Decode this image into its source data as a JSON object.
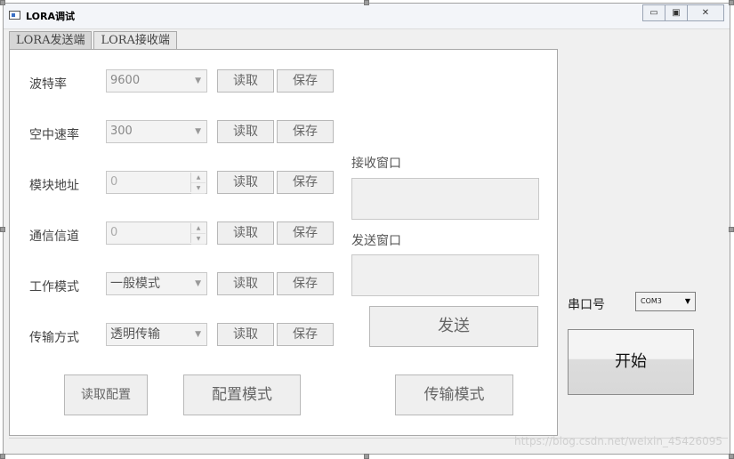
{
  "window": {
    "title": "LORA调试"
  },
  "window_controls": {
    "minimize": "▭",
    "maximize": "▣",
    "close": "✕"
  },
  "tabs": [
    {
      "label": "LORA发送端",
      "active": true
    },
    {
      "label": "LORA接收端",
      "active": false
    }
  ],
  "rows": [
    {
      "label": "波特率",
      "value": "9600",
      "control": "combo"
    },
    {
      "label": "空中速率",
      "value": "300",
      "control": "combo"
    },
    {
      "label": "模块地址",
      "value": "0",
      "control": "spin"
    },
    {
      "label": "通信信道",
      "value": "0",
      "control": "spin"
    },
    {
      "label": "工作模式",
      "value": "一般模式",
      "control": "combo"
    },
    {
      "label": "传输方式",
      "value": "透明传输",
      "control": "combo"
    }
  ],
  "row_buttons": {
    "read": "读取",
    "save": "保存"
  },
  "receive_window": {
    "label": "接收窗口",
    "value": ""
  },
  "send_window": {
    "label": "发送窗口",
    "value": ""
  },
  "send_button": "发送",
  "bottom_buttons": {
    "read_config": "读取配置",
    "config_mode": "配置模式",
    "transfer_mode": "传输模式"
  },
  "serial": {
    "label": "串口号",
    "selected": "COM3"
  },
  "start_button": "开始",
  "watermark": "https://blog.csdn.net/weixin_45426095"
}
